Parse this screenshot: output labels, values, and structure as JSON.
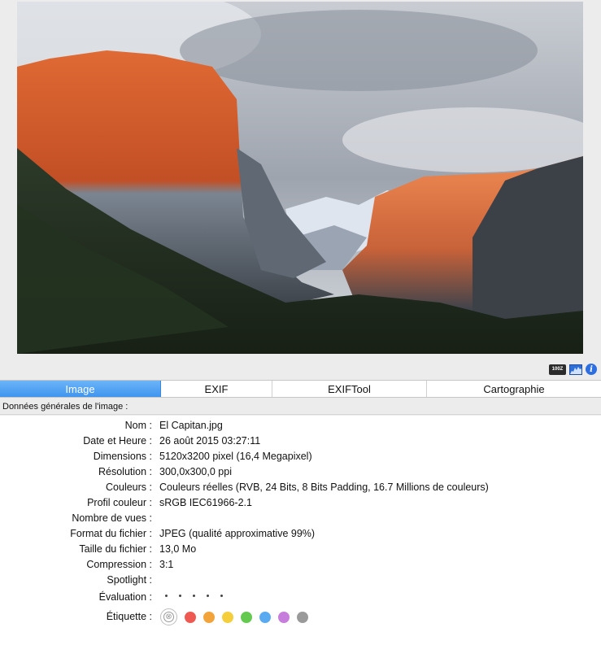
{
  "toolbar": {
    "zoom_badge": "100Z",
    "histogram_icon": "histogram-icon",
    "info_icon": "i"
  },
  "tabs": [
    {
      "label": "Image",
      "active": true
    },
    {
      "label": "EXIF",
      "active": false
    },
    {
      "label": "EXIFTool",
      "active": false
    },
    {
      "label": "Cartographie",
      "active": false
    }
  ],
  "section_title": "Données générales de l'image :",
  "properties": [
    {
      "key": "Nom :",
      "value": "El Capitan.jpg"
    },
    {
      "key": "Date et Heure :",
      "value": "26 août 2015 03:27:11"
    },
    {
      "key": "Dimensions :",
      "value": "5120x3200 pixel (16,4 Megapixel)"
    },
    {
      "key": "Résolution :",
      "value": "300,0x300,0 ppi"
    },
    {
      "key": "Couleurs :",
      "value": "Couleurs réelles (RVB, 24 Bits, 8 Bits Padding, 16.7 Millions de couleurs)"
    },
    {
      "key": "Profil couleur :",
      "value": "sRGB IEC61966-2.1"
    },
    {
      "key": "Nombre de vues :",
      "value": ""
    },
    {
      "key": "Format du fichier :",
      "value": "JPEG (qualité approximative 99%)"
    },
    {
      "key": "Taille du fichier :",
      "value": "13,0 Mo"
    },
    {
      "key": "Compression :",
      "value": "3:1"
    },
    {
      "key": "Spotlight :",
      "value": ""
    }
  ],
  "rating": {
    "key": "Évaluation :",
    "max_stars": 5,
    "value": 0
  },
  "label_picker": {
    "key": "Étiquette :",
    "none_icon": "⊗",
    "colors": [
      "#ee5a52",
      "#f2a33a",
      "#f4cf3b",
      "#63c94f",
      "#5aaaf2",
      "#c77ddb",
      "#9a9a9a"
    ]
  }
}
